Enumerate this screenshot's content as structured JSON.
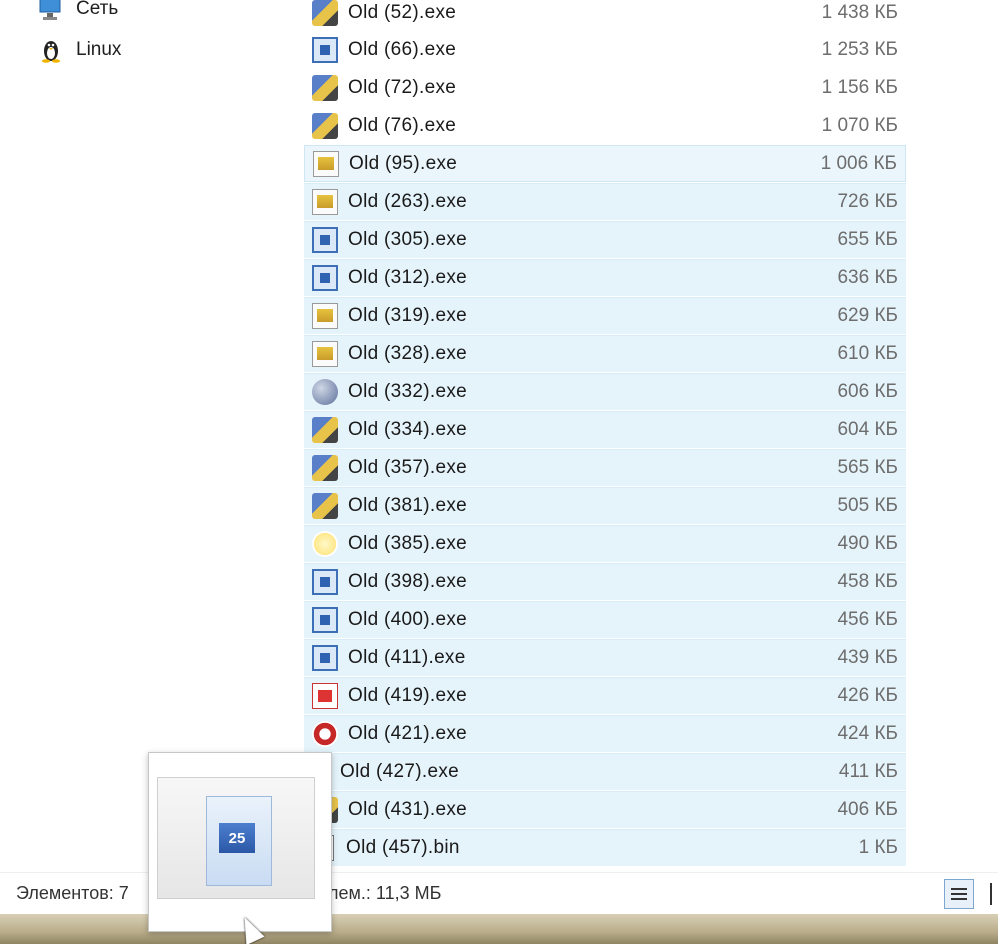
{
  "nav": {
    "items": [
      {
        "label": "Сеть",
        "icon": "network-icon"
      },
      {
        "label": "Linux",
        "icon": "linux-penguin-icon"
      }
    ]
  },
  "files": [
    {
      "name": "Old  (52).exe",
      "size": "1 438 КБ",
      "icon": "app-icon"
    },
    {
      "name": "Old  (66).exe",
      "size": "1 253 КБ",
      "icon": "window-icon"
    },
    {
      "name": "Old  (72).exe",
      "size": "1 156 КБ",
      "icon": "app-icon"
    },
    {
      "name": "Old  (76).exe",
      "size": "1 070 КБ",
      "icon": "app-icon"
    },
    {
      "name": "Old  (95).exe",
      "size": "1 006 КБ",
      "icon": "document-icon"
    },
    {
      "name": "Old  (263).exe",
      "size": "726 КБ",
      "icon": "document-icon"
    },
    {
      "name": "Old  (305).exe",
      "size": "655 КБ",
      "icon": "window-icon"
    },
    {
      "name": "Old  (312).exe",
      "size": "636 КБ",
      "icon": "window-icon"
    },
    {
      "name": "Old  (319).exe",
      "size": "629 КБ",
      "icon": "document-icon"
    },
    {
      "name": "Old  (328).exe",
      "size": "610 КБ",
      "icon": "document-icon"
    },
    {
      "name": "Old  (332).exe",
      "size": "606 КБ",
      "icon": "globe-icon"
    },
    {
      "name": "Old  (334).exe",
      "size": "604 КБ",
      "icon": "app-icon"
    },
    {
      "name": "Old  (357).exe",
      "size": "565 КБ",
      "icon": "app-icon"
    },
    {
      "name": "Old  (381).exe",
      "size": "505 КБ",
      "icon": "app-icon"
    },
    {
      "name": "Old  (385).exe",
      "size": "490 КБ",
      "icon": "sun-icon"
    },
    {
      "name": "Old  (398).exe",
      "size": "458 КБ",
      "icon": "window-icon"
    },
    {
      "name": "Old  (400).exe",
      "size": "456 КБ",
      "icon": "window-icon"
    },
    {
      "name": "Old  (411).exe",
      "size": "439 КБ",
      "icon": "window-icon"
    },
    {
      "name": "Old  (419).exe",
      "size": "426 КБ",
      "icon": "pdf-document-icon"
    },
    {
      "name": "Old  (421).exe",
      "size": "424 КБ",
      "icon": "red-logo-icon"
    },
    {
      "name": "Old  (427).exe",
      "size": "411 КБ",
      "icon": "black-file-icon"
    },
    {
      "name": "Old  (431).exe",
      "size": "406 КБ",
      "icon": "app-icon"
    },
    {
      "name": "Old  (457).bin",
      "size": "1 КБ",
      "icon": "blank-file-icon"
    }
  ],
  "status": {
    "count_text": "Элементов: 7",
    "selection_size_text": "лем.: 11,3 МБ"
  },
  "drag_ghost": {
    "badge_text": "25"
  },
  "colors": {
    "selection_bg": "#e5f3fb",
    "size_text": "#6d6d6d"
  }
}
